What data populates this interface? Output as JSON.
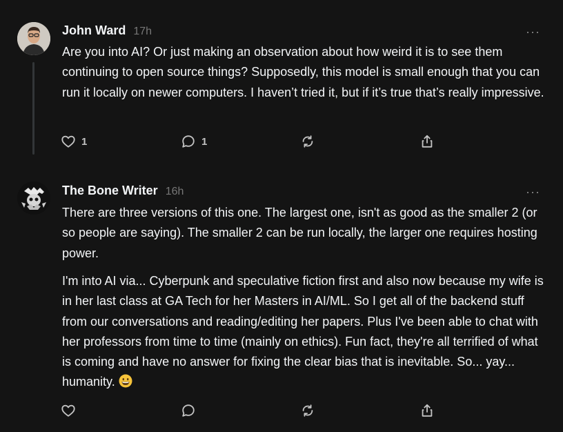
{
  "posts": [
    {
      "author": "John Ward",
      "time": "17h",
      "more_label": "···",
      "avatar_icon": "profile-photo",
      "paragraphs": [
        "Are you into AI? Or just making an observation about how weird it is to see them continuing to open source things? Supposedly, this model is small enough that you can run it locally on newer computers. I haven’t tried it, but if it’s true that’s really impressive."
      ],
      "likes": "1",
      "replies": "1"
    },
    {
      "author": "The Bone Writer",
      "time": "16h",
      "more_label": "···",
      "avatar_icon": "profile-photo",
      "paragraphs": [
        "There are three versions of this one. The largest one, isn't as good as the smaller 2 (or so people are saying). The smaller 2 can be run locally, the larger one requires hosting power.",
        "I'm into AI via... Cyberpunk and speculative fiction first and also now because my wife is in her last class at GA Tech for her Masters in AI/ML. So I get all of the backend stuff from our conversations and reading/editing her papers. Plus I've been able to chat with her professors from time to time (mainly on ethics). Fun fact, they're all terrified of what is coming and have no answer for fixing the clear bias that is inevitable. So... yay... humanity."
      ],
      "emoji_icon": "grinning-face-emoji",
      "likes": "",
      "replies": ""
    }
  ],
  "icons": {
    "like": "heart-icon",
    "reply": "comment-icon",
    "repost": "repost-icon",
    "share": "share-icon",
    "more": "more-icon"
  }
}
